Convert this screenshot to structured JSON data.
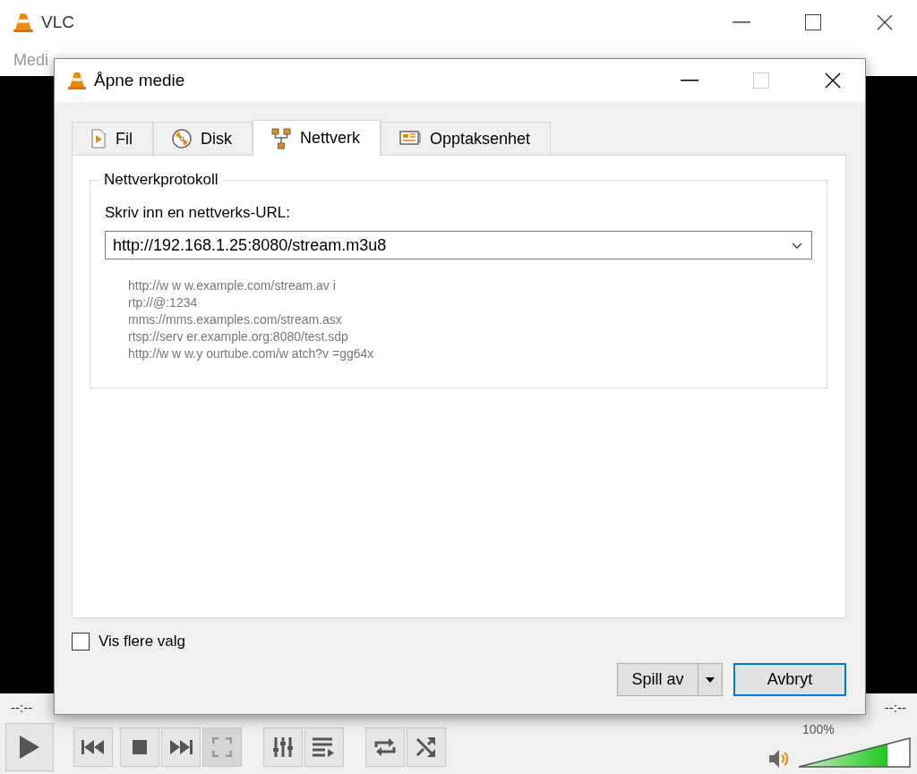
{
  "window": {
    "title": "VLC"
  },
  "menu": [
    "Medi"
  ],
  "dialog": {
    "title": "Åpne medie",
    "tabs": [
      {
        "label": "Fil",
        "selected": false
      },
      {
        "label": "Disk",
        "selected": false
      },
      {
        "label": "Nettverk",
        "selected": true
      },
      {
        "label": "Opptaksenhet",
        "selected": false
      }
    ],
    "group": {
      "title": "Nettverkprotokoll",
      "prompt": "Skriv inn en nettverks-URL:",
      "url": "http://192.168.1.25:8080/stream.m3u8",
      "examples": [
        "http://w w w.example.com/stream.av i",
        "rtp://@:1234",
        "mms://mms.examples.com/stream.asx",
        "rtsp://serv er.example.org:8080/test.sdp",
        "http://w w w.y ourtube.com/w atch?v =gg64x"
      ]
    },
    "more_options": {
      "label": "Vis flere valg",
      "checked": false
    },
    "buttons": [
      {
        "label": "Spill av",
        "kind": "split"
      },
      {
        "label": "Avbryt",
        "kind": "default"
      }
    ]
  },
  "player": {
    "elapsed": "--:--",
    "remaining": "--:--",
    "volume": {
      "reading": "100%",
      "level": 0.8
    },
    "controls": [
      {
        "disabled": false
      },
      {
        "disabled": false
      },
      {
        "disabled": false
      },
      {
        "disabled": true
      },
      {
        "disabled": false
      },
      {
        "disabled": false
      },
      {
        "disabled": false
      },
      {
        "disabled": false
      }
    ]
  }
}
